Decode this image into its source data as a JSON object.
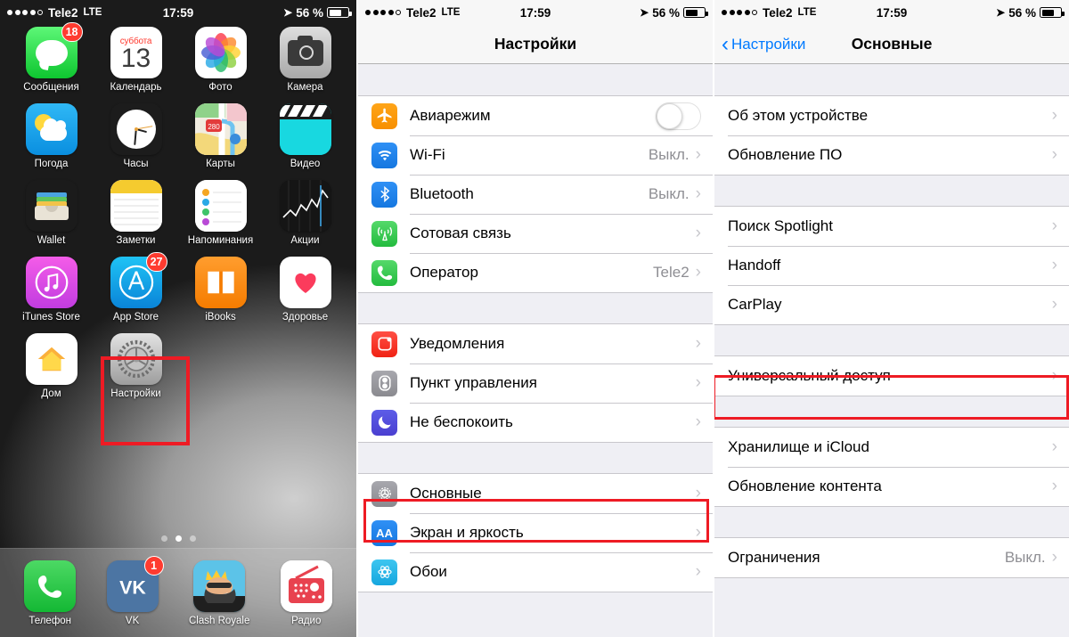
{
  "status_bar": {
    "carrier": "Tele2",
    "network": "LTE",
    "time": "17:59",
    "battery_percent": "56 %",
    "signal_dots_filled": 4,
    "signal_dots_total": 5
  },
  "home_screen": {
    "rows": [
      [
        {
          "label": "Сообщения",
          "icon": "messages-icon",
          "badge": "18"
        },
        {
          "label": "Календарь",
          "icon": "calendar-icon",
          "badge": "",
          "cal_weekday": "суббота",
          "cal_day": "13"
        },
        {
          "label": "Фото",
          "icon": "photos-icon",
          "badge": ""
        },
        {
          "label": "Камера",
          "icon": "camera-icon",
          "badge": ""
        }
      ],
      [
        {
          "label": "Погода",
          "icon": "weather-icon",
          "badge": ""
        },
        {
          "label": "Часы",
          "icon": "clock-icon",
          "badge": ""
        },
        {
          "label": "Карты",
          "icon": "maps-icon",
          "badge": "",
          "map_shield": "280"
        },
        {
          "label": "Видео",
          "icon": "videos-icon",
          "badge": ""
        }
      ],
      [
        {
          "label": "Wallet",
          "icon": "wallet-icon",
          "badge": ""
        },
        {
          "label": "Заметки",
          "icon": "notes-icon",
          "badge": ""
        },
        {
          "label": "Напоминания",
          "icon": "reminders-icon",
          "badge": ""
        },
        {
          "label": "Акции",
          "icon": "stocks-icon",
          "badge": ""
        }
      ],
      [
        {
          "label": "iTunes Store",
          "icon": "itunes-store-icon",
          "badge": ""
        },
        {
          "label": "App Store",
          "icon": "app-store-icon",
          "badge": "27"
        },
        {
          "label": "iBooks",
          "icon": "ibooks-icon",
          "badge": ""
        },
        {
          "label": "Здоровье",
          "icon": "health-icon",
          "badge": ""
        }
      ],
      [
        {
          "label": "Дом",
          "icon": "home-app-icon",
          "badge": ""
        },
        {
          "label": "Настройки",
          "icon": "settings-gear-icon",
          "badge": ""
        }
      ]
    ],
    "page_dots": {
      "count": 3,
      "active_index": 1
    },
    "dock": [
      {
        "label": "Телефон",
        "icon": "phone-icon",
        "badge": ""
      },
      {
        "label": "VK",
        "icon": "vk-icon",
        "badge": "1"
      },
      {
        "label": "Clash Royale",
        "icon": "clash-royale-icon",
        "badge": ""
      },
      {
        "label": "Радио",
        "icon": "radio-icon",
        "badge": ""
      }
    ],
    "highlight_target": "Настройки"
  },
  "settings_screen": {
    "title": "Настройки",
    "groups": [
      {
        "rows": [
          {
            "label": "Авиарежим",
            "icon": "airplane-icon",
            "control": "toggle",
            "toggle_on": false,
            "value": ""
          },
          {
            "label": "Wi-Fi",
            "icon": "wifi-icon",
            "control": "chevron",
            "value": "Выкл."
          },
          {
            "label": "Bluetooth",
            "icon": "bluetooth-icon",
            "control": "chevron",
            "value": "Выкл."
          },
          {
            "label": "Сотовая связь",
            "icon": "cellular-icon",
            "control": "chevron",
            "value": ""
          },
          {
            "label": "Оператор",
            "icon": "carrier-phone-icon",
            "control": "chevron",
            "value": "Tele2"
          }
        ]
      },
      {
        "rows": [
          {
            "label": "Уведомления",
            "icon": "notifications-icon",
            "control": "chevron",
            "value": ""
          },
          {
            "label": "Пункт управления",
            "icon": "control-center-icon",
            "control": "chevron",
            "value": ""
          },
          {
            "label": "Не беспокоить",
            "icon": "do-not-disturb-icon",
            "control": "chevron",
            "value": ""
          }
        ]
      },
      {
        "rows": [
          {
            "label": "Основные",
            "icon": "general-gear-icon",
            "control": "chevron",
            "value": "",
            "highlighted": true
          },
          {
            "label": "Экран и яркость",
            "icon": "display-brightness-icon",
            "control": "chevron",
            "value": ""
          },
          {
            "label": "Обои",
            "icon": "wallpaper-icon",
            "control": "chevron",
            "value": ""
          }
        ]
      }
    ],
    "highlight_target": "Основные"
  },
  "general_screen": {
    "back_label": "Настройки",
    "title": "Основные",
    "groups": [
      {
        "rows": [
          {
            "label": "Об этом устройстве",
            "control": "chevron",
            "value": ""
          },
          {
            "label": "Обновление ПО",
            "control": "chevron",
            "value": ""
          }
        ]
      },
      {
        "rows": [
          {
            "label": "Поиск Spotlight",
            "control": "chevron",
            "value": ""
          },
          {
            "label": "Handoff",
            "control": "chevron",
            "value": ""
          },
          {
            "label": "CarPlay",
            "control": "chevron",
            "value": ""
          }
        ]
      },
      {
        "rows": [
          {
            "label": "Универсальный доступ",
            "control": "chevron",
            "value": "",
            "highlighted": true
          }
        ]
      },
      {
        "rows": [
          {
            "label": "Хранилище и iCloud",
            "control": "chevron",
            "value": ""
          },
          {
            "label": "Обновление контента",
            "control": "chevron",
            "value": ""
          }
        ]
      },
      {
        "rows": [
          {
            "label": "Ограничения",
            "control": "chevron",
            "value": "Выкл."
          }
        ]
      }
    ],
    "highlight_target": "Универсальный доступ"
  },
  "colors": {
    "highlight_red": "#ee1b24",
    "ios_blue": "#007aff",
    "list_bg": "#efeff4",
    "separator": "#c8c7cc",
    "value_gray": "#8e8e93"
  }
}
